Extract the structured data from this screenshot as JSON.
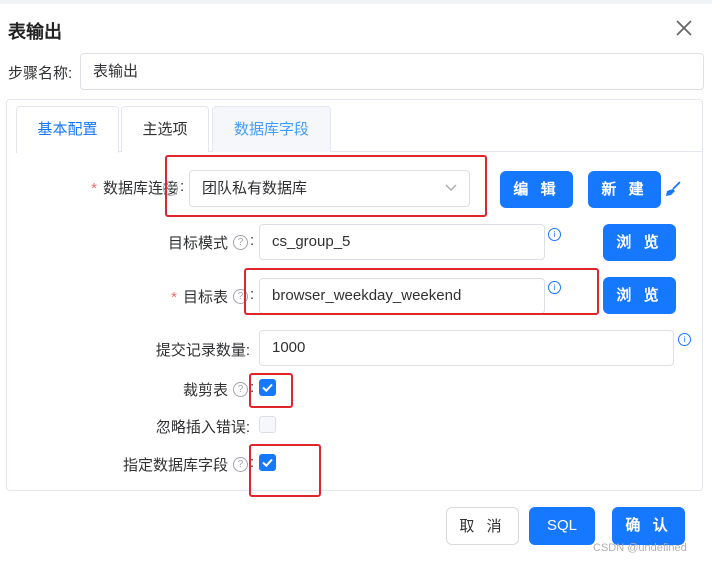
{
  "dialog": {
    "title": "表输出"
  },
  "step_name": {
    "label": "步骤名称:",
    "value": "表输出"
  },
  "tabs": [
    {
      "label": "基本配置"
    },
    {
      "label": "主选项"
    },
    {
      "label": "数据库字段"
    }
  ],
  "form": {
    "db_connection": {
      "label": "数据库连接",
      "value": "团队私有数据库",
      "edit_button": "编 辑",
      "new_button": "新 建"
    },
    "target_schema": {
      "label": "目标模式",
      "value": "cs_group_5",
      "browse_button": "浏 览"
    },
    "target_table": {
      "label": "目标表",
      "value": "browser_weekday_weekend",
      "browse_button": "浏 览"
    },
    "commit_size": {
      "label": "提交记录数量:",
      "value": "1000"
    },
    "truncate_table": {
      "label": "裁剪表",
      "checked": true
    },
    "ignore_insert_errors": {
      "label": "忽略插入错误:",
      "checked": false
    },
    "specify_db_fields": {
      "label": "指定数据库字段",
      "checked": true
    }
  },
  "footer": {
    "cancel": "取 消",
    "sql": "SQL",
    "confirm": "确 认"
  },
  "watermark": "CSDN @undefined",
  "colors": {
    "primary": "#1677ff",
    "highlight_box": "#e0262b",
    "required": "#f56c6c"
  }
}
